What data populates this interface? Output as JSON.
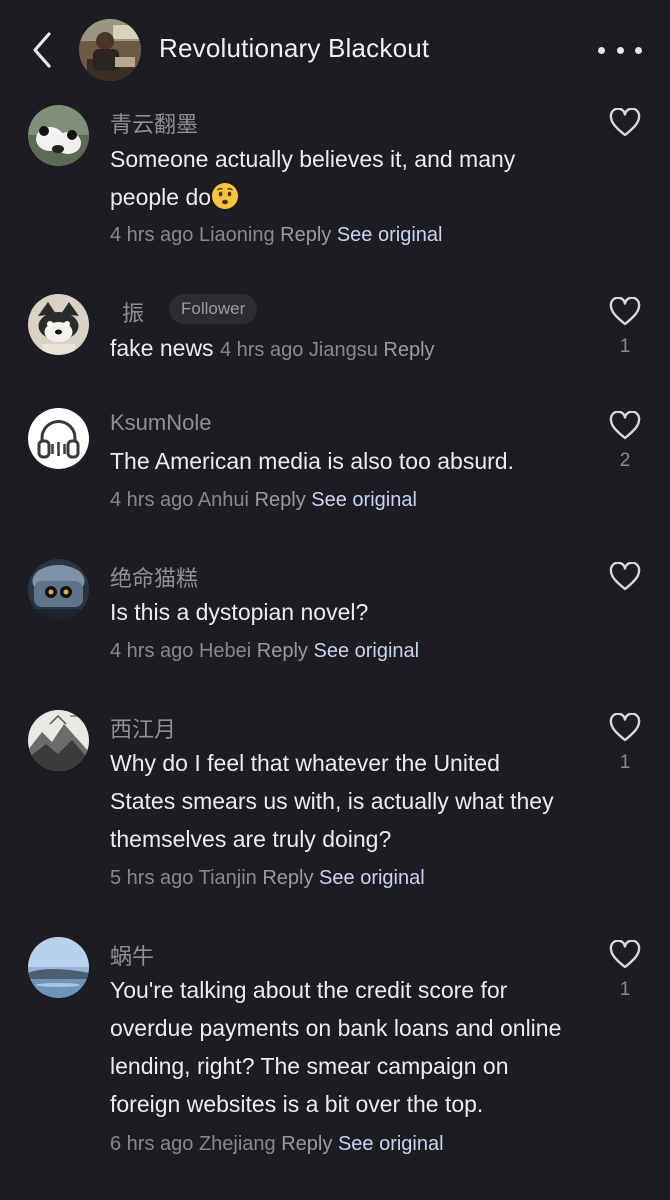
{
  "header": {
    "title": "Revolutionary Blackout"
  },
  "comments": [
    {
      "username": "青云翻墨",
      "text": "Someone actually believes it, and many people do",
      "time": "4 hrs ago",
      "location": "Liaoning",
      "reply": "Reply",
      "see_original": "See original",
      "likes": ""
    },
    {
      "username": "振",
      "badge": "Follower",
      "text": "fake news",
      "time": "4 hrs ago",
      "location": "Jiangsu",
      "reply": "Reply",
      "likes": "1"
    },
    {
      "username": "KsumNole",
      "text": "The American media is also too absurd.",
      "time": "4 hrs ago",
      "location": "Anhui",
      "reply": "Reply",
      "see_original": "See original",
      "likes": "2"
    },
    {
      "username": "绝命猫糕",
      "text": "Is this a dystopian novel?",
      "time": "4 hrs ago",
      "location": "Hebei",
      "reply": "Reply",
      "see_original": "See original",
      "likes": ""
    },
    {
      "username": "西江月",
      "text": "Why do I feel that whatever the United States smears us with, is actually what they themselves are truly doing?",
      "time": "5 hrs ago",
      "location": "Tianjin",
      "reply": "Reply",
      "see_original": "See original",
      "likes": "1"
    },
    {
      "username": "蜗牛",
      "text": "You're talking about the credit score for overdue payments on bank loans and online lending, right? The smear campaign on foreign websites is a bit over the top.",
      "time": "6 hrs ago",
      "location": "Zhejiang",
      "reply": "Reply",
      "see_original": "See original",
      "likes": "1"
    }
  ],
  "icons": {
    "back": "chevron-left-icon",
    "more": "more-dots-icon",
    "like": "heart-outline-icon",
    "emoji": "worried-face-emoji"
  },
  "colors": {
    "background": "#1c1c22",
    "text": "#ececef",
    "muted": "#88888e",
    "link": "#c9d4f0"
  }
}
